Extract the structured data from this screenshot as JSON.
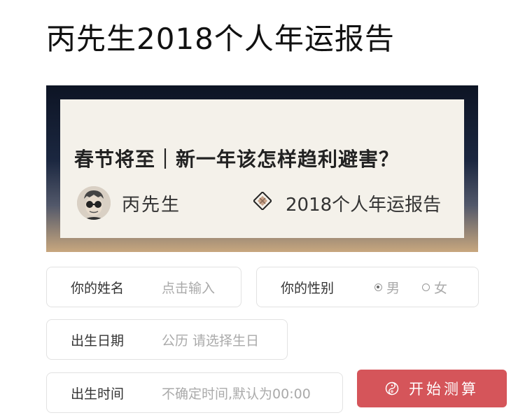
{
  "page": {
    "title": "丙先生2018个人年运报告"
  },
  "banner": {
    "headline": "春节将至｜新一年该怎样趋利避害？",
    "author": "丙先生",
    "report_label": "2018个人年运报告"
  },
  "form": {
    "name": {
      "label": "你的姓名",
      "placeholder": "点击输入"
    },
    "gender": {
      "label": "你的性别",
      "options": [
        "男",
        "女"
      ],
      "selected": "男"
    },
    "birth_date": {
      "label": "出生日期",
      "placeholder": "公历 请选择生日"
    },
    "birth_time": {
      "label": "出生时间",
      "placeholder": "不确定时间,默认为00:00"
    },
    "submit_label": "开始测算"
  },
  "colors": {
    "accent": "#d5555a"
  }
}
